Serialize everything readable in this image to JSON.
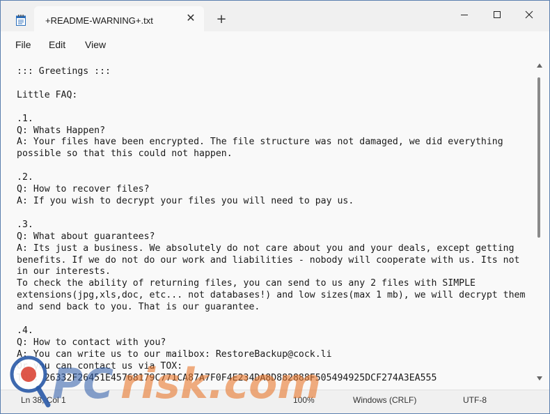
{
  "window": {
    "tab_title": "+README-WARNING+.txt",
    "tab_close_glyph": "✕",
    "new_tab_glyph": "+"
  },
  "menu": [
    "File",
    "Edit",
    "View"
  ],
  "document_lines": [
    "::: Greetings :::",
    "",
    "Little FAQ:",
    "",
    ".1.",
    "Q: Whats Happen?",
    "A: Your files have been encrypted. The file structure was not damaged, we did everything",
    "possible so that this could not happen.",
    "",
    ".2.",
    "Q: How to recover files?",
    "A: If you wish to decrypt your files you will need to pay us.",
    "",
    ".3.",
    "Q: What about guarantees?",
    "A: Its just a business. We absolutely do not care about you and your deals, except getting",
    "benefits. If we do not do our work and liabilities - nobody will cooperate with us. Its not",
    "in our interests.",
    "To check the ability of returning files, you can send to us any 2 files with SIMPLE",
    "extensions(jpg,xls,doc, etc... not databases!) and low sizes(max 1 mb), we will decrypt them",
    "and send back to you. That is our guarantee.",
    "",
    ".4.",
    "Q: How to contact with you?",
    "A: You can write us to our mailbox: RestoreBackup@cock.li",
    "Or you can contact us via TOX:",
    "TOX: 26332F26451E45768179C771CA87A7F0F4E234DA8D882888F505494925DCF274A3EA555"
  ],
  "status": {
    "position": "Ln 38, Col 1",
    "zoom": "100%",
    "line_ending": "Windows (CRLF)",
    "encoding": "UTF-8"
  },
  "watermark_text": "PCrisk.com",
  "icons": [
    "notepad-icon",
    "close-icon",
    "plus-icon",
    "minimize-icon",
    "maximize-icon",
    "gear-icon",
    "scroll-up-icon",
    "scroll-down-icon"
  ],
  "colors": {
    "watermark_blue": "#2a5aa8",
    "watermark_orange": "#e8762b",
    "accent": "#0067c0"
  }
}
